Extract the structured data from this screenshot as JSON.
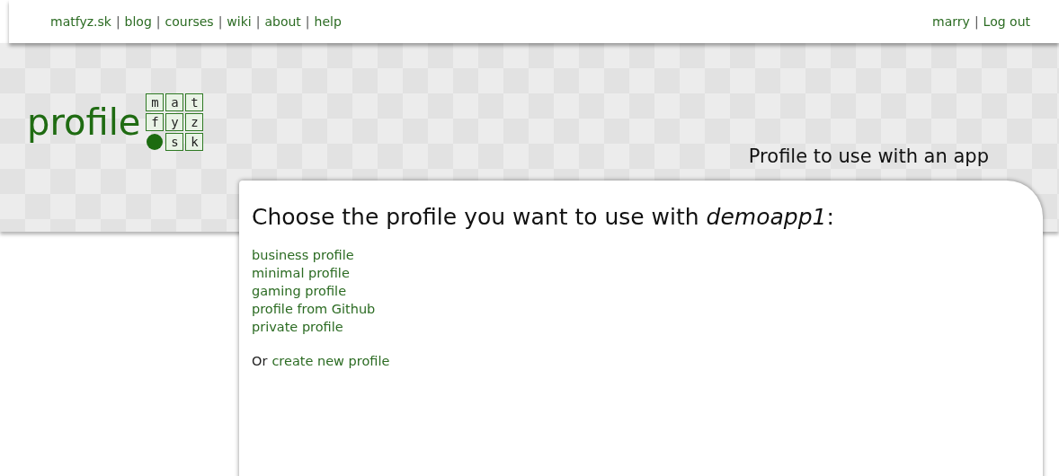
{
  "top_nav": {
    "links": [
      "matfyz.sk",
      "blog",
      "courses",
      "wiki",
      "about",
      "help"
    ],
    "separator": "|"
  },
  "user_nav": {
    "links": [
      "marry",
      "Log out"
    ],
    "separator": "|"
  },
  "logo": {
    "word": "profile",
    "letters": [
      "m",
      "a",
      "t",
      "f",
      "y",
      "z",
      "s",
      "k"
    ]
  },
  "subtitle": "Profile to use with an app",
  "card": {
    "heading": "Choose the profile you want to use with *demoapp1*:",
    "profiles": [
      "business profile",
      "minimal profile",
      "gaming profile",
      "profile from Github",
      "private profile"
    ],
    "create_prefix": "Or",
    "create_link": "create new profile"
  }
}
